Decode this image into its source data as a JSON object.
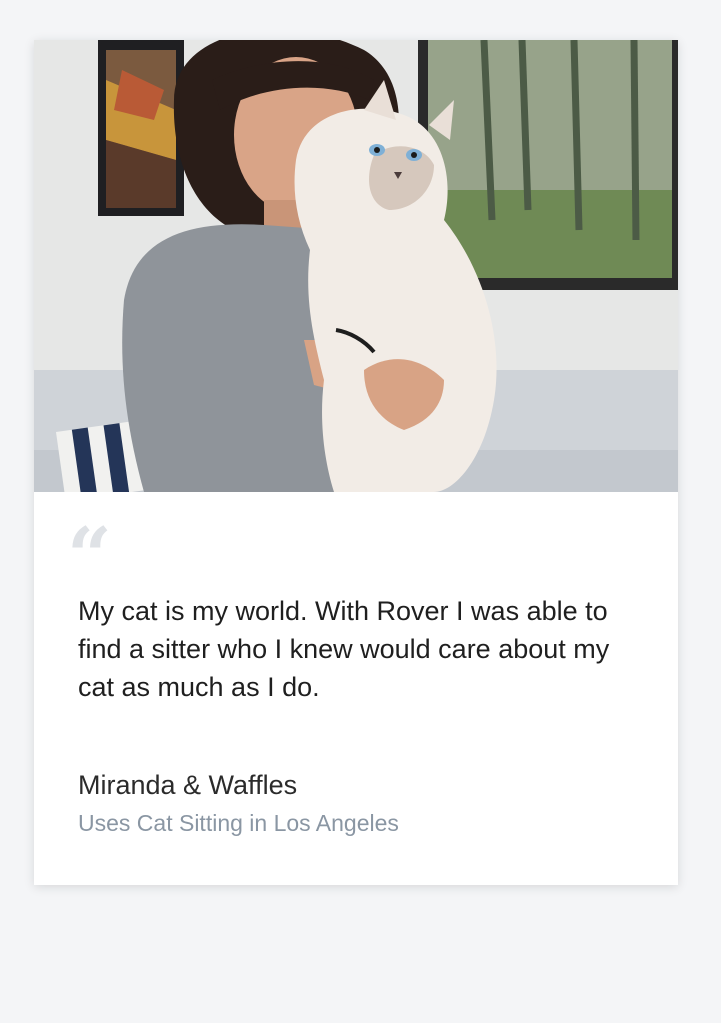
{
  "testimonial": {
    "quote_mark": "“",
    "quote": "My cat is my world. With Rover I was able to find a sitter who I knew would care about my cat as much as I do.",
    "author": "Miranda & Waffles",
    "meta": "Uses Cat Sitting in Los Angeles"
  },
  "colors": {
    "page_background": "#f4f5f7",
    "card_background": "#ffffff",
    "quote_text": "#1f1f1f",
    "meta_text": "#8a96a3",
    "quote_mark": "#dfe2e6"
  },
  "icons": {
    "quote_mark": "quote-mark-icon"
  }
}
